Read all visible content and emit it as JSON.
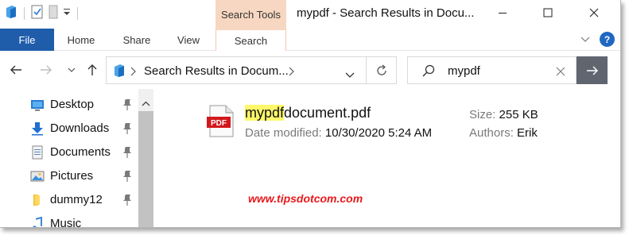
{
  "window": {
    "title": "mypdf - Search Results in Docu...",
    "context_tab_group": "Search Tools"
  },
  "ribbon": {
    "tabs": [
      {
        "label": "File",
        "active": false
      },
      {
        "label": "Home",
        "active": false
      },
      {
        "label": "Share",
        "active": false
      },
      {
        "label": "View",
        "active": false
      },
      {
        "label": "Search",
        "active": true
      }
    ]
  },
  "address_bar": {
    "path": "Search Results in Docum...",
    "search_value": "mypdf"
  },
  "nav_pane": {
    "items": [
      {
        "label": "Desktop",
        "icon": "desktop-icon",
        "pinned": true
      },
      {
        "label": "Downloads",
        "icon": "downloads-icon",
        "pinned": true
      },
      {
        "label": "Documents",
        "icon": "documents-icon",
        "pinned": true
      },
      {
        "label": "Pictures",
        "icon": "pictures-icon",
        "pinned": true
      },
      {
        "label": "dummy12",
        "icon": "folder-icon",
        "pinned": true
      },
      {
        "label": "Music",
        "icon": "music-icon",
        "pinned": false
      }
    ]
  },
  "results": [
    {
      "name_match": "mypdf",
      "name_rest": "document.pdf",
      "icon": "pdf-file-icon",
      "date_label": "Date modified:",
      "date_value": "10/30/2020 5:24 AM",
      "size_label": "Size:",
      "size_value": "255 KB",
      "authors_label": "Authors:",
      "authors_value": "Erik"
    }
  ],
  "watermark": "www.tipsdotcom.com",
  "colors": {
    "file_tab": "#1f5dab",
    "search_tools_context": "#f7d7c1",
    "search_highlight": "#fff86a",
    "go_button": "#5f6670",
    "watermark": "#e8191c"
  }
}
